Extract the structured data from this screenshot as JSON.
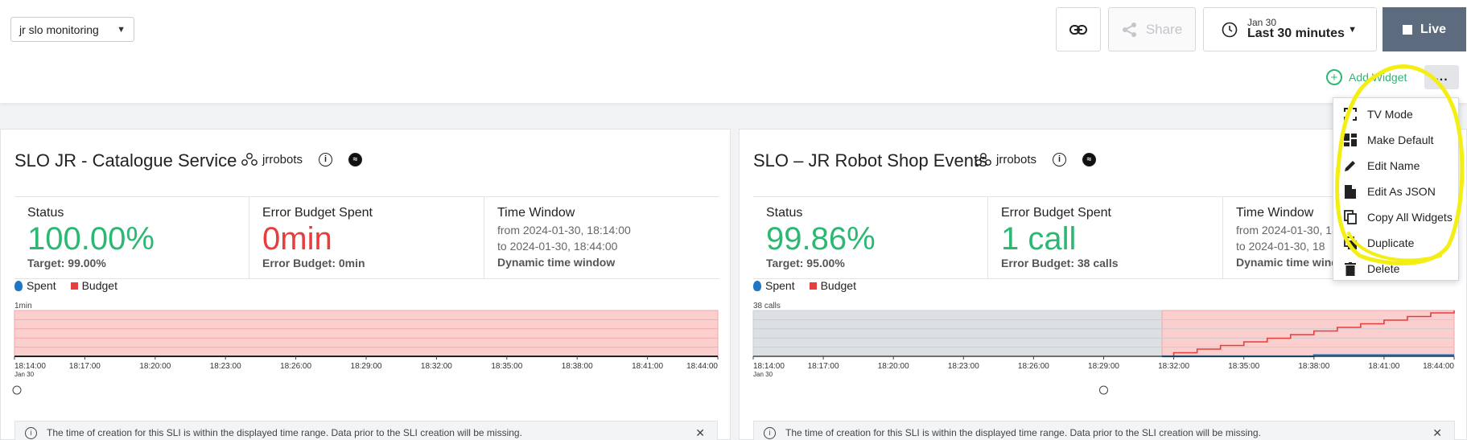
{
  "header": {
    "dashboard_name": "jr slo monitoring",
    "share_label": "Share",
    "time_date": "Jan 30",
    "time_range": "Last 30 minutes",
    "live_label": "Live",
    "add_widget_label": "Add Widget",
    "more_label": "..."
  },
  "menu": {
    "items": [
      "TV Mode",
      "Make Default",
      "Edit Name",
      "Edit As JSON",
      "Copy All Widgets",
      "Duplicate",
      "Delete"
    ]
  },
  "panels": [
    {
      "title": "SLO JR - Catalogue Service",
      "team": "jrrobots",
      "status_label": "Status",
      "status_value": "100.00%",
      "target": "Target:  99.00%",
      "ebs_label": "Error Budget Spent",
      "ebs_value": "0min",
      "error_budget": "Error Budget:  0min",
      "tw_label": "Time Window",
      "tw_from": "from 2024-01-30, 18:14:00",
      "tw_to": "to 2024-01-30, 18:44:00",
      "tw_type": "Dynamic time window",
      "y_label": "1min",
      "notice": "The time of creation for this SLI is within the displayed time range. Data prior to the SLI creation will be missing."
    },
    {
      "title": "SLO – JR Robot Shop Events",
      "team": "jrrobots",
      "status_label": "Status",
      "status_value": "99.86%",
      "target": "Target:  95.00%",
      "ebs_label": "Error Budget Spent",
      "ebs_value": "1 call",
      "error_budget": "Error Budget:  38 calls",
      "tw_label": "Time Window",
      "tw_from": "from 2024-01-30, 18",
      "tw_to": "to 2024-01-30, 18",
      "tw_type": "Dynamic time wind",
      "y_label": "38 calls",
      "notice": "The time of creation for this SLI is within the displayed time range. Data prior to the SLI creation will be missing."
    }
  ],
  "legend": {
    "spent": "Spent",
    "budget": "Budget"
  },
  "x_ticks": [
    "18:14:00",
    "18:17:00",
    "18:20:00",
    "18:23:00",
    "18:26:00",
    "18:29:00",
    "18:32:00",
    "18:35:00",
    "18:38:00",
    "18:41:00",
    "18:44:00"
  ],
  "x_sublabel": "Jan 30",
  "chart_data": [
    {
      "type": "area",
      "x": [
        "18:14:00",
        "18:17:00",
        "18:20:00",
        "18:23:00",
        "18:26:00",
        "18:29:00",
        "18:32:00",
        "18:35:00",
        "18:38:00",
        "18:41:00",
        "18:44:00"
      ],
      "ylabel": "1min",
      "series": [
        {
          "name": "Budget",
          "color": "#e63d3d",
          "values": [
            1,
            1,
            1,
            1,
            1,
            1,
            1,
            1,
            1,
            1,
            1
          ]
        },
        {
          "name": "Spent",
          "color": "#1f77c5",
          "values": [
            0,
            0,
            0,
            0,
            0,
            0,
            0,
            0,
            0,
            0,
            0
          ]
        }
      ]
    },
    {
      "type": "area",
      "x": [
        "18:14:00",
        "18:17:00",
        "18:20:00",
        "18:23:00",
        "18:26:00",
        "18:29:00",
        "18:32:00",
        "18:35:00",
        "18:38:00",
        "18:41:00",
        "18:44:00"
      ],
      "ylabel": "38 calls",
      "ylim": [
        0,
        38
      ],
      "budget_start": "18:31:30",
      "series": [
        {
          "name": "Budget",
          "color": "#e63d3d",
          "step_x": [
            "18:31:30",
            "18:32:00",
            "18:33:00",
            "18:34:00",
            "18:35:00",
            "18:36:00",
            "18:37:00",
            "18:38:00",
            "18:39:00",
            "18:40:00",
            "18:41:00",
            "18:42:00",
            "18:43:00",
            "18:44:00"
          ],
          "values": [
            0,
            3,
            6,
            9,
            12,
            15,
            18,
            21,
            24,
            27,
            30,
            33,
            36,
            38
          ]
        },
        {
          "name": "Spent",
          "color": "#1f77c5",
          "step_x": [
            "18:31:30",
            "18:38:00",
            "18:44:00"
          ],
          "values": [
            0,
            1,
            1
          ]
        }
      ]
    }
  ]
}
